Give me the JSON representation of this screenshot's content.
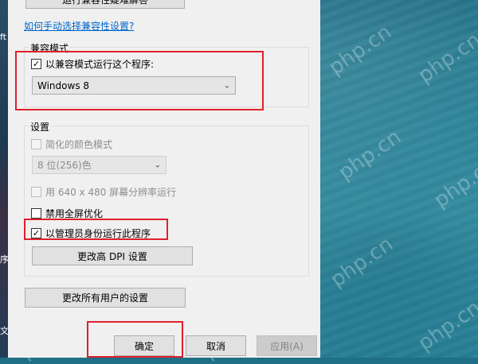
{
  "dialog": {
    "top_button_label": "运行兼容性疑难解答",
    "manual_link": "如何手动选择兼容性设置?",
    "compat_group": {
      "legend": "兼容模式",
      "run_in_compat_label": "以兼容模式运行这个程序:",
      "run_in_compat_checked": true,
      "os_selected": "Windows 8"
    },
    "settings_group": {
      "legend": "设置",
      "reduced_color_label": "简化的颜色模式",
      "color_depth_selected": "8 位(256)色",
      "resolution_label": "用 640 x 480 屏幕分辨率运行",
      "disable_fullscreen_label": "禁用全屏优化",
      "run_as_admin_label": "以管理员身份运行此程序",
      "run_as_admin_checked": true,
      "high_dpi_button": "更改高 DPI 设置"
    },
    "all_users_button": "更改所有用户的设置",
    "ok_button": "确定",
    "cancel_button": "取消",
    "apply_button": "应用(A)"
  },
  "background": {
    "watermark_text": "php.cn",
    "left_fragments": [
      "ft",
      "序",
      "文"
    ]
  },
  "colors": {
    "highlight_red": "#e0202c",
    "dialog_bg": "#f0f0f0",
    "link_blue": "#0066cc"
  },
  "icons": {
    "checkmark": "check-icon",
    "dropdown": "chevron-down-icon"
  }
}
